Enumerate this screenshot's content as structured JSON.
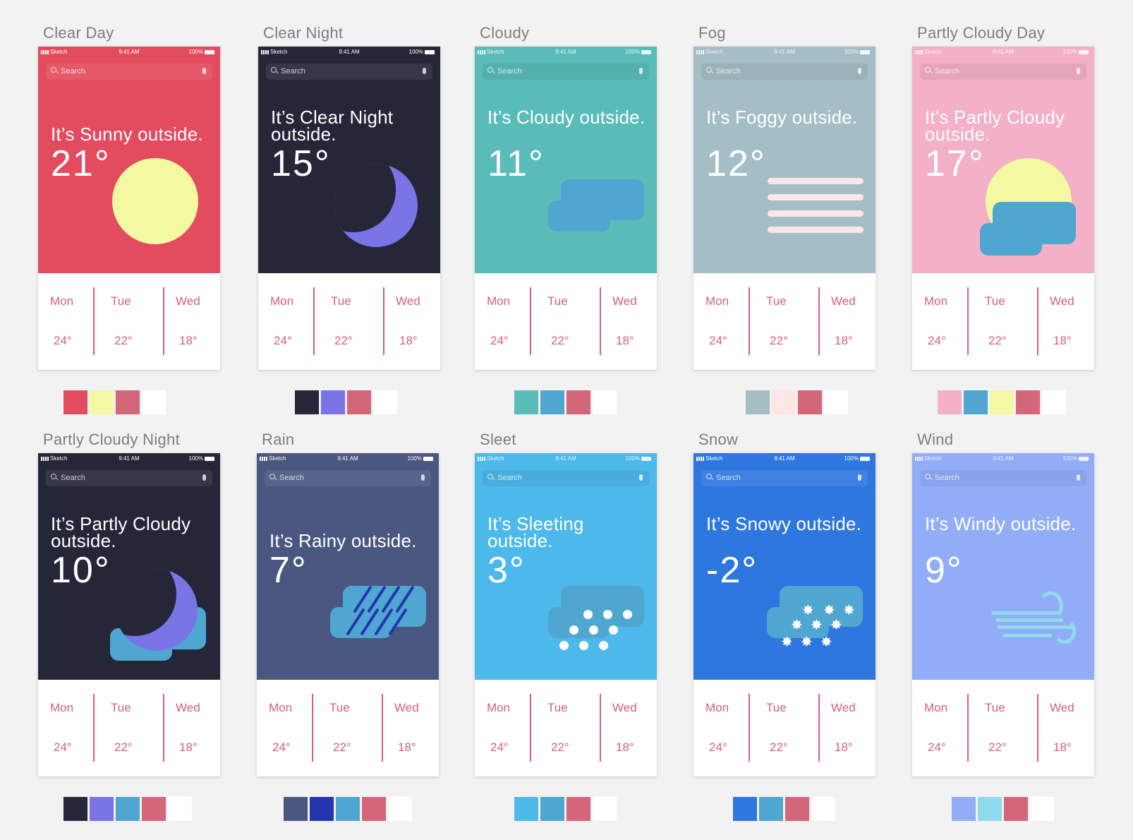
{
  "status": {
    "carrier": "Sketch",
    "time": "9:41 AM",
    "battery": "100%"
  },
  "search_placeholder": "Search",
  "forecast": {
    "days": [
      "Mon",
      "Tue",
      "Wed"
    ],
    "temps": [
      "24°",
      "22°",
      "18°"
    ]
  },
  "cards": [
    {
      "title": "Clear Day",
      "headline": "It’s Sunny outside.",
      "temp": "21°",
      "bg": "#e34b5f",
      "icon": "sun-icon",
      "swatches": [
        "#e34b5f",
        "#f3f8a3",
        "#d4667a",
        "#ffffff"
      ]
    },
    {
      "title": "Clear Night",
      "headline": "It’s Clear Night outside.",
      "temp": "15°",
      "bg": "#252638",
      "icon": "moon-icon",
      "swatches": [
        "#252638",
        "#7a74e6",
        "#d4667a",
        "#ffffff"
      ]
    },
    {
      "title": "Cloudy",
      "headline": "It’s Cloudy outside.",
      "temp": "11°",
      "bg": "#5abcb8",
      "icon": "cloud-icon",
      "swatches": [
        "#5abcb8",
        "#4fa6d0",
        "#d4667a",
        "#ffffff"
      ]
    },
    {
      "title": "Fog",
      "headline": "It’s Foggy outside.",
      "temp": "12°",
      "bg": "#a5bec5",
      "icon": "fog-icon",
      "swatches": [
        "#a5bec5",
        "#fce6e6",
        "#d4667a",
        "#ffffff"
      ]
    },
    {
      "title": "Partly Cloudy Day",
      "headline": "It’s Partly Cloudy outside.",
      "temp": "17°",
      "bg": "#f3b0c7",
      "icon": "partly-cloudy-day-icon",
      "swatches": [
        "#f3b0c7",
        "#4fa6d0",
        "#f3f8a3",
        "#d4667a",
        "#ffffff"
      ]
    },
    {
      "title": "Partly Cloudy Night",
      "headline": "It’s Partly Cloudy outside.",
      "temp": "10°",
      "bg": "#252638",
      "icon": "partly-cloudy-night-icon",
      "swatches": [
        "#252638",
        "#7a74e6",
        "#4fa6d0",
        "#d4667a",
        "#ffffff"
      ]
    },
    {
      "title": "Rain",
      "headline": "It’s Rainy outside.",
      "temp": "7°",
      "bg": "#4a5780",
      "icon": "rain-icon",
      "swatches": [
        "#4a5780",
        "#2535ae",
        "#4fa6d0",
        "#d4667a",
        "#ffffff"
      ]
    },
    {
      "title": "Sleet",
      "headline": "It’s Sleeting outside.",
      "temp": "3°",
      "bg": "#4db8ea",
      "icon": "sleet-icon",
      "swatches": [
        "#4db8ea",
        "#4fa6d0",
        "#d4667a",
        "#ffffff"
      ]
    },
    {
      "title": "Snow",
      "headline": "It’s Snowy outside.",
      "temp": "-2°",
      "bg": "#2e77de",
      "icon": "snow-icon",
      "swatches": [
        "#2e77de",
        "#4fa6d0",
        "#d4667a",
        "#ffffff"
      ]
    },
    {
      "title": "Wind",
      "headline": "It’s Windy outside.",
      "temp": "9°",
      "bg": "#92adf8",
      "icon": "wind-icon",
      "swatches": [
        "#92adf8",
        "#8fdaeb",
        "#d4667a",
        "#ffffff"
      ]
    }
  ]
}
